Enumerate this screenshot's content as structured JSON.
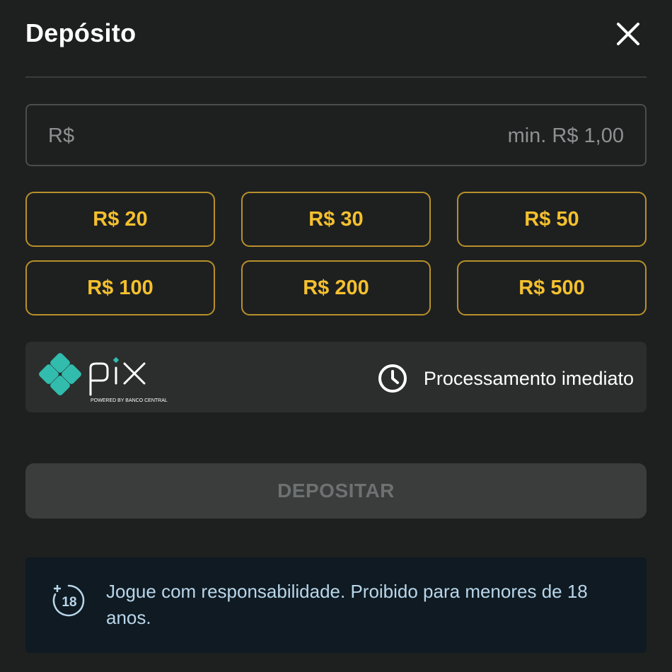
{
  "header": {
    "title": "Depósito"
  },
  "amount": {
    "prefix": "R$",
    "value": "",
    "min_hint": "min. R$ 1,00"
  },
  "presets": [
    "R$ 20",
    "R$ 30",
    "R$ 50",
    "R$ 100",
    "R$ 200",
    "R$ 500"
  ],
  "payment": {
    "logo_text": "pix",
    "logo_subtext": "POWERED BY BANCO CENTRAL",
    "processing_text": "Processamento imediato"
  },
  "deposit_button": {
    "label": "DEPOSITAR"
  },
  "notice": {
    "age_badge": "18",
    "text": "Jogue com responsabilidade. Proibido para menores de 18 anos."
  },
  "colors": {
    "background": "#1e2020",
    "accent_gold": "#f4c02e",
    "preset_border": "#b8902a",
    "pix_teal": "#32bcad",
    "notice_bg": "#0f1a22",
    "notice_text": "#b9d6ea"
  },
  "icons": {
    "close": "close-icon",
    "clock": "clock-icon",
    "age": "age-18-icon",
    "pix": "pix-logo"
  }
}
